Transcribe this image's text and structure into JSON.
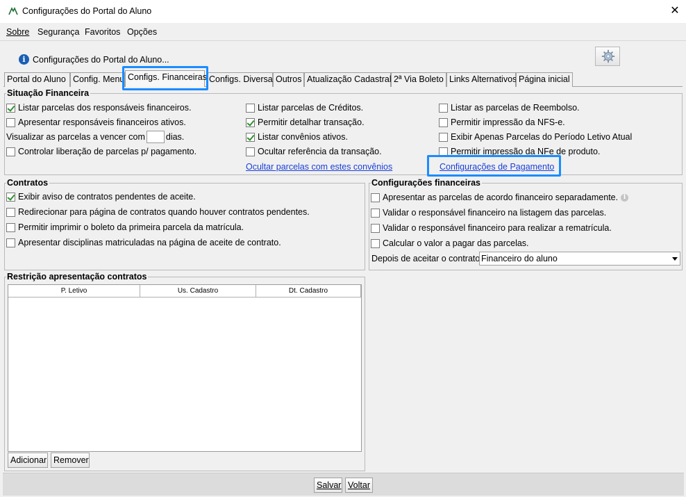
{
  "window": {
    "title": "Configurações do Portal do Aluno",
    "close": "✕"
  },
  "menu": [
    "Sobre",
    "Segurança",
    "Favoritos",
    "Opções"
  ],
  "header": {
    "text": "Configurações do Portal do Aluno..."
  },
  "tabs": [
    "Portal do Aluno",
    "Config. Menu",
    "Configs. Financeiras",
    "Configs. Diversas",
    "Outros",
    "Atualização Cadastral",
    "2ª Via Boleto",
    "Links Alternativos",
    "Página inicial"
  ],
  "situacao": {
    "title": "Situação Financeira",
    "col1": [
      {
        "label": "Listar parcelas dos responsáveis financeiros.",
        "checked": true
      },
      {
        "label": "Apresentar responsáveis financeiros ativos.",
        "checked": false
      },
      {
        "label_before": "Visualizar as parcelas a vencer com",
        "label_after": "dias."
      },
      {
        "label": "Controlar liberação de parcelas p/ pagamento.",
        "checked": false
      }
    ],
    "col2": [
      {
        "label": "Listar parcelas de Créditos.",
        "checked": false
      },
      {
        "label": "Permitir detalhar transação.",
        "checked": true
      },
      {
        "label": "Listar convênios ativos.",
        "checked": true
      },
      {
        "label": "Ocultar referência da transação.",
        "checked": false
      }
    ],
    "col2_link": "Ocultar parcelas com estes convênios",
    "col3": [
      {
        "label": "Listar as parcelas de Reembolso.",
        "checked": false
      },
      {
        "label": "Permitir impressão da NFS-e.",
        "checked": false
      },
      {
        "label": "Exibir Apenas Parcelas do Período Letivo Atual",
        "checked": false
      },
      {
        "label": "Permitir impressão da NFe de produto.",
        "checked": false
      }
    ],
    "col3_link": "Configurações de Pagamento"
  },
  "contratos": {
    "title": "Contratos",
    "items": [
      {
        "label": "Exibir aviso de contratos pendentes de aceite.",
        "checked": true
      },
      {
        "label": "Redirecionar para página de contratos quando houver contratos pendentes.",
        "checked": false
      },
      {
        "label": "Permitir imprimir o boleto da primeira parcela da matrícula.",
        "checked": false
      },
      {
        "label": "Apresentar disciplinas matriculadas na página de aceite de contrato.",
        "checked": false
      }
    ]
  },
  "config_fin": {
    "title": "Configurações financeiras",
    "items": [
      {
        "label": "Apresentar as parcelas de acordo financeiro separadamente.",
        "checked": false
      },
      {
        "label": "Validar o responsável financeiro na listagem das parcelas.",
        "checked": false
      },
      {
        "label": "Validar o responsável financeiro para realizar a rematrícula.",
        "checked": false
      },
      {
        "label": "Calcular o valor a pagar das parcelas.",
        "checked": false
      }
    ],
    "select_label": "Depois de aceitar o contrato:",
    "select_value": "Financeiro do aluno"
  },
  "restricao": {
    "title": "Restrição apresentação contratos",
    "columns": [
      "P. Letivo",
      "Us. Cadastro",
      "Dt. Cadastro"
    ],
    "add_button": "Adicionar",
    "remove_button": "Remover"
  },
  "footer": {
    "save": "Salvar",
    "back": "Voltar"
  },
  "colors": {
    "highlight": "#1a8cff",
    "link": "#1a3fd6",
    "check": "#2f8f2f"
  }
}
